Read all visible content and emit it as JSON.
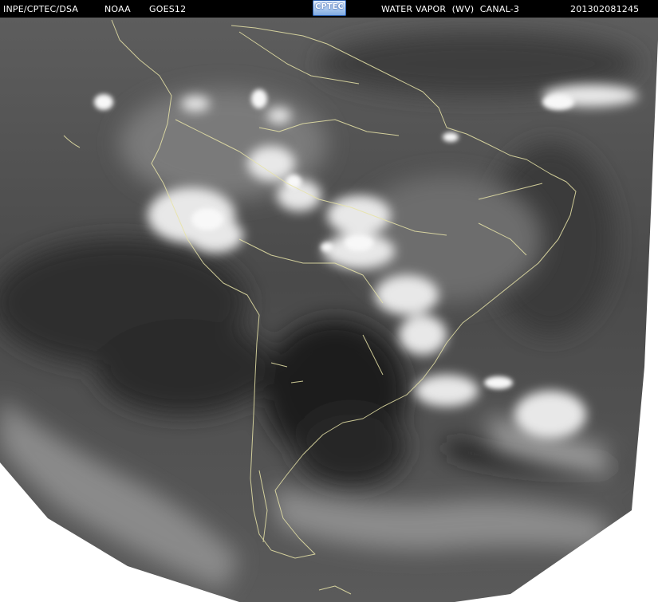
{
  "header": {
    "org": "INPE/CPTEC/DSA",
    "agency": "NOAA",
    "satellite": "GOES12",
    "product": "WATER VAPOR  (WV)  CANAL-3",
    "timestamp": "201302081245"
  },
  "logo": {
    "text": "CPTEC"
  },
  "colors": {
    "background": "#ffffff",
    "header": "#000000",
    "coastline": "#e8e4a8",
    "cloud": "#f4f4f4"
  }
}
